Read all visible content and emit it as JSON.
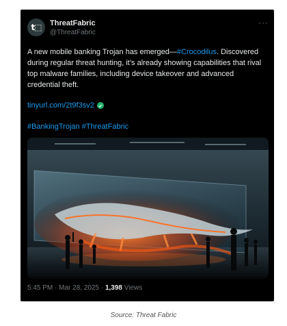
{
  "tweet": {
    "author": {
      "display_name": "ThreatFabric",
      "handle": "@ThreatFabric",
      "avatar_icon": "threatfabric-logo-icon"
    },
    "more_icon": "more-horizontal-icon",
    "text": {
      "part1": "A new mobile banking Trojan has emerged—",
      "hashtag1": "#Crocodilus",
      "part2": ". Discovered during regular threat hunting, it’s already showing capabilities that rival top malware families, including device takeover and advanced credential theft."
    },
    "link": "tinyurl.com/2t9f3sv2",
    "link_badge_icon": "verified-check-icon",
    "hashtags": [
      "#BankingTrojan",
      "#ThreatFabric"
    ],
    "media_alt_icon": "crocodile-hologram-image",
    "timestamp": "5:45 PM · Mar 28, 2025 · ",
    "views_count": "1,398",
    "views_label": " Views"
  },
  "caption": "Source: Threat Fabric",
  "colors": {
    "card_bg": "#000000",
    "text": "#e7e9ea",
    "muted": "#71767b",
    "accent": "#1d9bf0",
    "badge": "#1fb169"
  }
}
